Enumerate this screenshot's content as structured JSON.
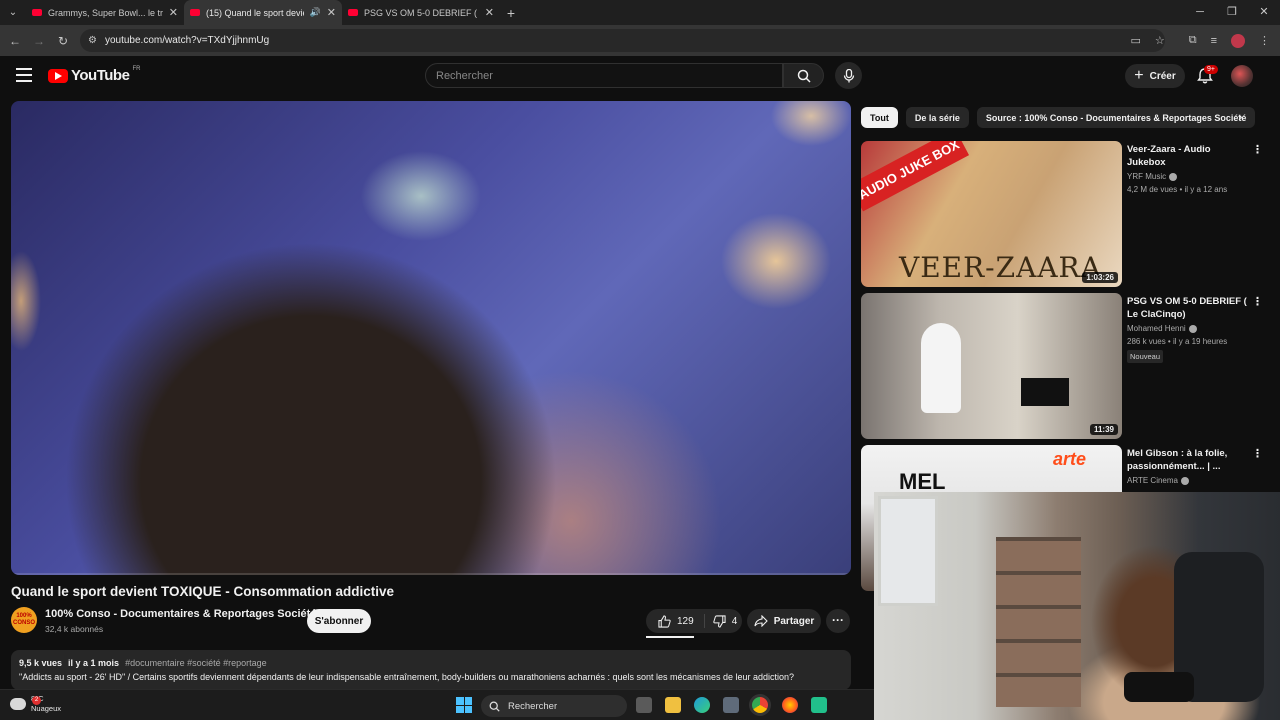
{
  "browser": {
    "tabs": [
      {
        "title": "Grammys, Super Bowl... le triomphe",
        "active": false
      },
      {
        "title": "(15) Quand le sport devient",
        "active": true
      },
      {
        "title": "PSG VS OM 5-0 DEBRIEF ( Le Cl",
        "active": false
      }
    ],
    "url": "youtube.com/watch?v=TXdYjjhnmUg"
  },
  "youtube": {
    "logo_text": "YouTube",
    "country_code": "FR",
    "search_placeholder": "Rechercher",
    "create_label": "Créer",
    "notification_count": "9+"
  },
  "video": {
    "title": "Quand le sport devient TOXIQUE - Consommation addictive",
    "channel": "100% Conso - Documentaires & Reportages Société",
    "subscribers": "32,4 k abonnés",
    "avatar_text": "100% CONSO",
    "subscribe_label": "S'abonner",
    "likes": "129",
    "dislikes": "4",
    "share_label": "Partager",
    "views": "9,5 k vues",
    "age": "il y a 1 mois",
    "tags": "#documentaire #société #reportage",
    "description": "\"Addicts au sport - 26' HD\" / Certains sportifs deviennent dépendants de leur indispensable entraînement, body-builders ou marathoniens acharnés : quels sont les mécanismes de leur addiction?"
  },
  "sidebar": {
    "chips": [
      "Tout",
      "De la série",
      "Source : 100% Conso - Documentaires & Reportages Société"
    ],
    "recommendations": [
      {
        "title": "Veer-Zaara - Audio Jukebox",
        "channel": "YRF Music",
        "meta": "4,2 M de vues • il y a 12 ans",
        "duration": "1:03:26",
        "badge": "",
        "thumb_text_1": "AUDIO JUKE BOX",
        "thumb_text_2": "VEER-ZAARA"
      },
      {
        "title": "PSG VS OM 5-0 DEBRIEF ( Le ClaCinqo)",
        "channel": "Mohamed Henni",
        "meta": "286 k vues • il y a 19 heures",
        "duration": "11:39",
        "badge": "Nouveau"
      },
      {
        "title": "Mel Gibson : à la folie, passionnément... | ...",
        "channel": "ARTE Cinema",
        "meta": "",
        "duration": "",
        "badge": "",
        "thumb_text_1": "MEL",
        "thumb_text_2": "arte"
      }
    ]
  },
  "taskbar": {
    "temperature": "8°C",
    "condition": "Nuageux",
    "weather_badge": "2",
    "search_label": "Rechercher"
  },
  "colors": {
    "youtube_red": "#ff0000",
    "background": "#0f0f0f",
    "chip_bg": "#272727"
  }
}
